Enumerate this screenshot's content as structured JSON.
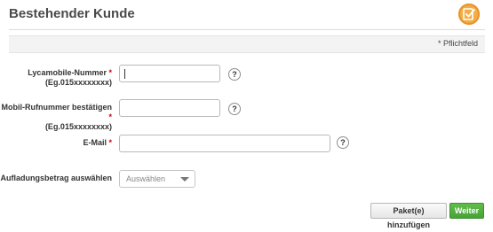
{
  "header": {
    "title": "Bestehender Kunde",
    "icon": "checklist-icon",
    "icon_color": "#f3ad46"
  },
  "required_note": "* Pflichtfeld",
  "form": {
    "lyca_number": {
      "label": "Lycamobile-Nummer",
      "required_mark": "*",
      "hint": "(Eg.015xxxxxxxx)",
      "value": ""
    },
    "confirm_number": {
      "label": "Mobil-Rufnummer bestätigen",
      "required_mark": "*",
      "hint": "(Eg.015xxxxxxxx)",
      "value": ""
    },
    "email": {
      "label": "E-Mail",
      "required_mark": "*",
      "value": ""
    },
    "amount": {
      "label": "Aufladungsbetrag auswählen",
      "selected": "Auswählen"
    },
    "help_symbol": "?"
  },
  "buttons": {
    "add_package": "Paket(e) hinzufügen",
    "next": "Weiter",
    "next_color": "#4fae3d"
  }
}
